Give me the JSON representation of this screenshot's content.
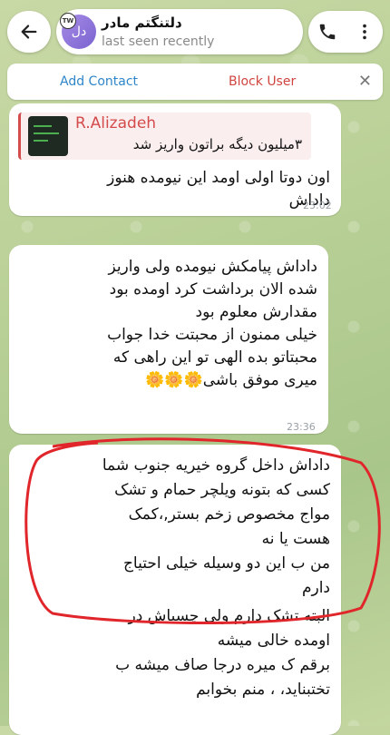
{
  "header": {
    "chat_name": "دلتنگتم مادر",
    "status": "last seen recently",
    "avatar_initials": "دل",
    "avatar_badge": "TW"
  },
  "contact_bar": {
    "add_contact": "Add Contact",
    "block_user": "Block User"
  },
  "messages": [
    {
      "reply_author": "R.Alizadeh",
      "reply_text": "۳میلیون دیگه براتون واریز شد",
      "lines": [
        "اون دوتا اولی اومد این نیومده هنوز",
        "داداش"
      ],
      "time": "23:02"
    },
    {
      "lines": [
        "داداش پیامکش نیومده ولی واریز",
        "شده الان برداشت کرد اومده بود",
        "مقدارش معلوم بود",
        "خیلی ممنون از محبتت خدا جواب",
        "محبتاتو بده الهی تو این راهی که",
        "میری موفق باشی🌼🌼🌼"
      ],
      "time": "23:36"
    },
    {
      "lines": [
        "داداش داخل گروه خیریه جنوب شما",
        "کسی که بتونه ویلچر حمام و تشک",
        "مواج مخصوص زخم بستر,،کمک",
        "هست یا نه",
        "من ب این دو وسیله خیلی احتیاج",
        "دارم",
        "البته تشک دارم ولی چسباش در",
        "اومده خالی میشه",
        "برقم ک میره درجا صاف میشه ب",
        "تختبناید، ، منم بخوابم"
      ]
    }
  ],
  "colors": {
    "accent": "#2f86c9",
    "danger": "#d0453f",
    "reply": "#d44b4b",
    "annotation": "#e0262a"
  }
}
